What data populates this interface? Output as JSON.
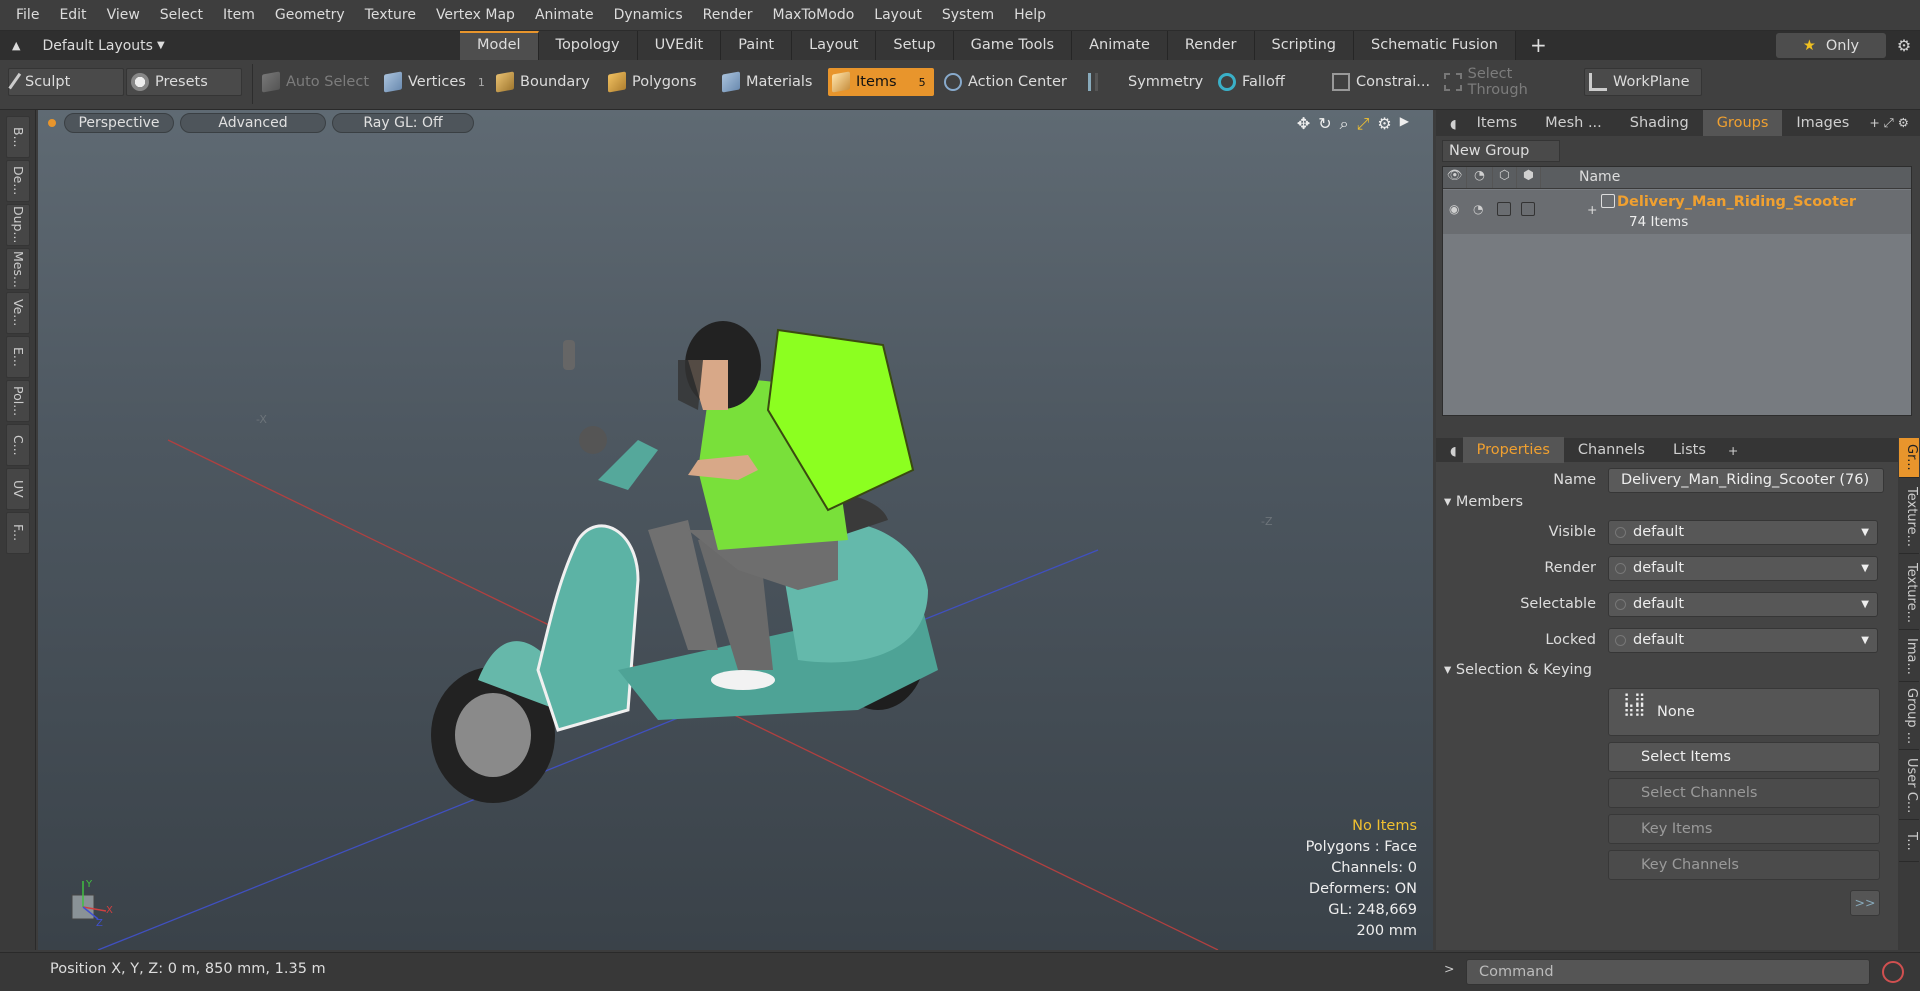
{
  "menu": [
    "File",
    "Edit",
    "View",
    "Select",
    "Item",
    "Geometry",
    "Texture",
    "Vertex Map",
    "Animate",
    "Dynamics",
    "Render",
    "MaxToModo",
    "Layout",
    "System",
    "Help"
  ],
  "layouts_label": "Default Layouts",
  "tabs": [
    "Model",
    "Topology",
    "UVEdit",
    "Paint",
    "Layout",
    "Setup",
    "Game Tools",
    "Animate",
    "Render",
    "Scripting",
    "Schematic Fusion"
  ],
  "only_label": "Only",
  "toolbar": {
    "sculpt": "Sculpt",
    "presets": "Presets",
    "auto_select": "Auto Select",
    "vertices": "Vertices",
    "vertices_count": "1",
    "boundary": "Boundary",
    "polygons": "Polygons",
    "materials": "Materials",
    "items": "Items",
    "items_count": "5",
    "action_center": "Action Center",
    "symmetry": "Symmetry",
    "falloff": "Falloff",
    "constraints": "Constrai...",
    "select_through": "Select Through",
    "workplane": "WorkPlane"
  },
  "left_tools": [
    "B...",
    "De...",
    "Dup...",
    "Mes...",
    "Ve...",
    "E...",
    "Pol...",
    "C...",
    "UV",
    "F..."
  ],
  "viewport": {
    "mode": "Perspective",
    "shading": "Advanced",
    "raygl": "Ray GL: Off",
    "hud": {
      "no_items": "No Items",
      "polygons": "Polygons : Face",
      "channels": "Channels: 0",
      "deformers": "Deformers: ON",
      "gl": "GL: 248,669",
      "scale": "200 mm"
    }
  },
  "groups_panel": {
    "tabs": [
      "Items",
      "Mesh ...",
      "Shading",
      "Groups",
      "Images"
    ],
    "new_group": "New Group",
    "name_header": "Name",
    "group_name": "Delivery_Man_Riding_Scooter",
    "group_count": "74 Items"
  },
  "properties": {
    "tabs": [
      "Properties",
      "Channels",
      "Lists"
    ],
    "name_label": "Name",
    "name_value": "Delivery_Man_Riding_Scooter (76)",
    "members_section": "Members",
    "visible_label": "Visible",
    "render_label": "Render",
    "selectable_label": "Selectable",
    "locked_label": "Locked",
    "default_value": "default",
    "selection_section": "Selection & Keying",
    "none_label": "None",
    "select_items": "Select Items",
    "select_channels": "Select Channels",
    "key_items": "Key Items",
    "key_channels": "Key Channels",
    "more": ">>",
    "side_tabs": [
      "Gr...",
      "Texture...",
      "Texture...",
      "Ima...",
      "Group ...",
      "User C...",
      "T..."
    ]
  },
  "status": {
    "position": "Position X, Y, Z:   0 m, 850 mm, 1.35 m",
    "command_placeholder": "Command"
  }
}
